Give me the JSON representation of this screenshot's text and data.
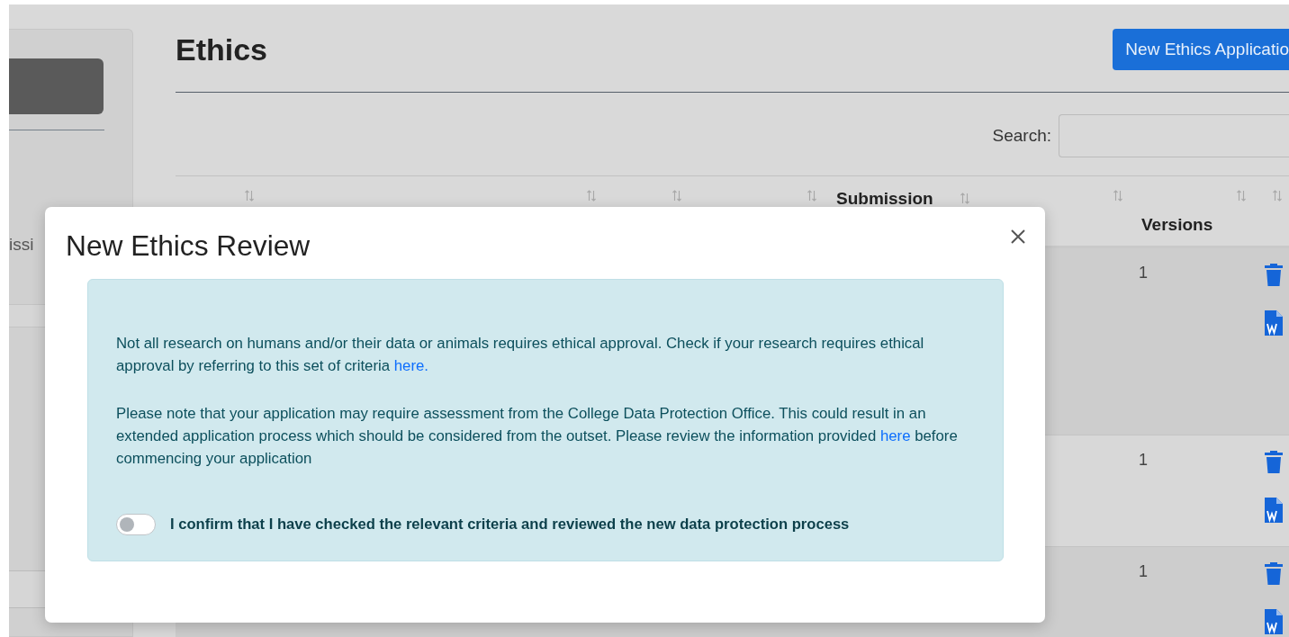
{
  "sidebar": {
    "label": "issi"
  },
  "page": {
    "title": "Ethics",
    "new_button": "New Ethics Applicatio",
    "search": {
      "label": "Search:"
    }
  },
  "table": {
    "columns": [
      {
        "sortable": true
      },
      {
        "sortable": true
      },
      {
        "sortable": true
      },
      {
        "sortable": true
      },
      {
        "heading": "Submission",
        "sortable": true
      },
      {
        "sortable": true
      },
      {
        "heading": "Versions",
        "sortable": true
      },
      {
        "sortable": true
      }
    ],
    "rows": [
      {
        "versions": "1",
        "actions": [
          {
            "kind": "delete"
          },
          {
            "kind": "word"
          }
        ]
      },
      {
        "versions": "1",
        "actions": [
          {
            "kind": "delete"
          },
          {
            "kind": "word"
          }
        ]
      },
      {
        "versions": "1",
        "actions": [
          {
            "kind": "delete"
          },
          {
            "kind": "word"
          }
        ]
      }
    ]
  },
  "modal": {
    "title": "New Ethics Review",
    "paragraphs": [
      {
        "before": "Not all research on humans and/or their data or animals requires ethical approval. Check if your research requires ethical approval by referring to this set of criteria ",
        "link": "here."
      },
      {
        "before": "Please note that your application may require assessment from the College Data Protection Office. This could result in an extended application process which should be considered from the outset. Please review the information provided ",
        "link": "here",
        "after": " before commencing your application"
      }
    ],
    "confirm": {
      "label": "I confirm that I have checked the relevant criteria and reviewed the new data protection process",
      "on": false
    }
  }
}
